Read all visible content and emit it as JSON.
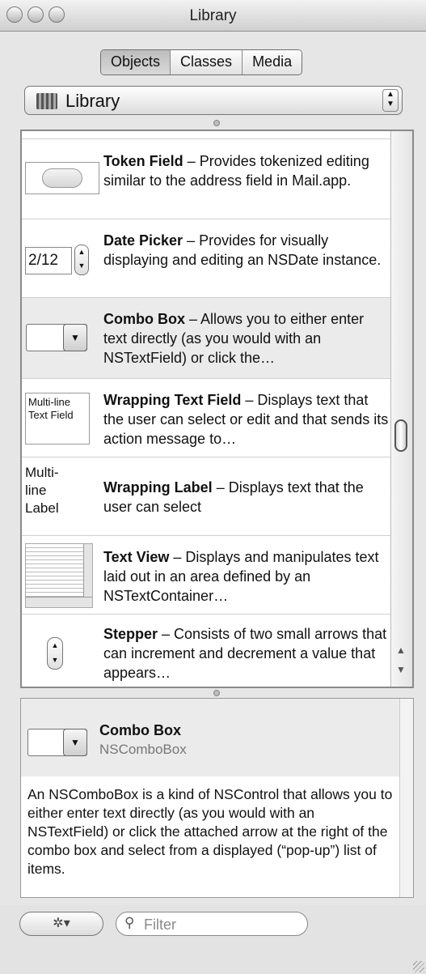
{
  "window": {
    "title": "Library"
  },
  "tabs": [
    {
      "label": "Objects",
      "selected": true
    },
    {
      "label": "Classes",
      "selected": false
    },
    {
      "label": "Media",
      "selected": false
    }
  ],
  "library_popup": {
    "selected": "Library"
  },
  "items": [
    {
      "name": "Token Field",
      "description": " – Provides tokenized editing similar to the address field in Mail.app."
    },
    {
      "name": "Date Picker",
      "description": " – Provides for visually displaying and editing an NSDate instance.",
      "preview_value": "2/12"
    },
    {
      "name": "Combo Box",
      "description": " – Allows you to either enter text directly (as you would with an NSTextField) or click the…",
      "selected": true
    },
    {
      "name": "Wrapping Text Field",
      "description": " – Displays text that the user can select or edit and that sends its action message to…",
      "preview_text": "Multi-line Text Field"
    },
    {
      "name": "Wrapping Label",
      "description": " – Displays text that the user can select",
      "preview_text": "Multi-\nline\nLabel"
    },
    {
      "name": "Text View",
      "description": " – Displays and manipulates text laid out in an area defined by an NSTextContainer…"
    },
    {
      "name": "Stepper",
      "description": " – Consists of two small arrows that can increment and decrement a value that appears…"
    }
  ],
  "detail": {
    "title": "Combo Box",
    "class_name": "NSComboBox",
    "body": "An NSComboBox is a kind of NSControl that allows you to either enter text directly (as you would with an NSTextField) or click the attached arrow at the right of the combo box and select from a displayed (“pop-up”) list of items."
  },
  "bottom": {
    "action_icon": "gear-icon",
    "filter_placeholder": "Filter"
  }
}
